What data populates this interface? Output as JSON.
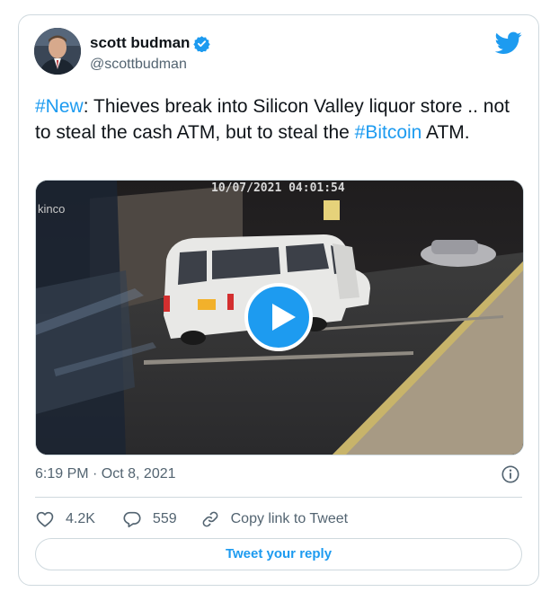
{
  "author": {
    "name": "scott budman",
    "handle": "@scottbudman",
    "verified": true
  },
  "tweet": {
    "segments": [
      {
        "text": "#New",
        "hashtag": true
      },
      {
        "text": ": Thieves break into Silicon Valley liquor store .. not to steal the cash ATM, but to steal the ",
        "hashtag": false
      },
      {
        "text": "#Bitcoin",
        "hashtag": true
      },
      {
        "text": " ATM.",
        "hashtag": false
      }
    ],
    "video_overlay_date": "10/07/2021 04:01:54",
    "video_overlay_sign": "kinco",
    "timestamp": "6:19 PM · Oct 8, 2021"
  },
  "actions": {
    "likes": "4.2K",
    "replies": "559",
    "copy_link_label": "Copy link to Tweet"
  },
  "reply_button_label": "Tweet your reply",
  "icons": {
    "brand": "twitter-bird-icon",
    "verified": "verified-badge-icon",
    "info": "info-icon",
    "like": "heart-icon",
    "reply": "speech-bubble-icon",
    "copy": "link-icon",
    "play": "play-icon"
  },
  "colors": {
    "accent": "#1d9bf0",
    "text": "#0f1419",
    "secondary": "#536471",
    "border": "#cfd9de"
  }
}
